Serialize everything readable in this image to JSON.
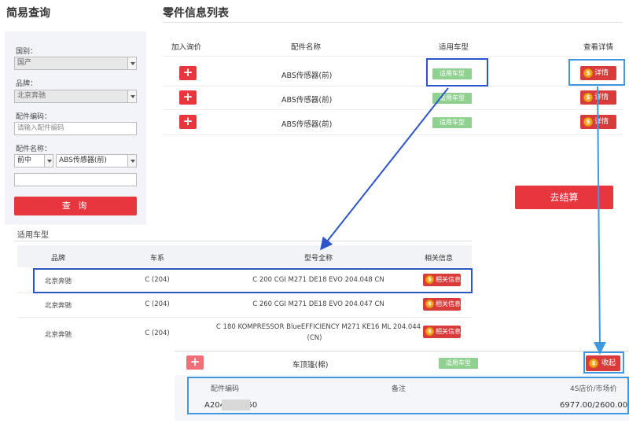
{
  "search": {
    "title": "简易查询",
    "country_label": "国别：",
    "country_value": "国产",
    "brand_label": "品牌：",
    "brand_value": "北京奔驰",
    "code_label": "配件编码：",
    "code_placeholder": "请输入配件编码",
    "name_label": "配件名称：",
    "position_value": "前中",
    "name_value": "ABS传感器(前)",
    "query_button": "查 询"
  },
  "parts": {
    "title": "零件信息列表",
    "columns": [
      "加入询价",
      "配件名称",
      "适用车型",
      "查看详情"
    ],
    "rows": [
      {
        "add": "+",
        "name": "ABS传感器(前)",
        "model_tag": "适用车型",
        "detail": "详情"
      },
      {
        "add": "+",
        "name": "ABS传感器(前)",
        "model_tag": "适用车型",
        "detail": "详情"
      },
      {
        "add": "+",
        "name": "ABS传感器(前)",
        "model_tag": "适用车型",
        "detail": "详情"
      }
    ],
    "checkout_button": "去结算"
  },
  "vehicles": {
    "title": "适用车型",
    "columns": [
      "品牌",
      "车系",
      "型号全称",
      "相关信息"
    ],
    "rows": [
      {
        "brand": "北京奔驰",
        "series": "C (204)",
        "model": "C 200 CGI M271 DE18 EVO 204.048 CN",
        "info": "相关信息"
      },
      {
        "brand": "北京奔驰",
        "series": "C (204)",
        "model": "C 260 CGI M271 DE18 EVO 204.047 CN",
        "info": "相关信息"
      },
      {
        "brand": "北京奔驰",
        "series": "C (204)",
        "model": "C 180 KOMPRESSOR BlueEFFICIENCY M271 KE16 ML 204.044",
        "model2": "(CN)",
        "info": "相关信息"
      }
    ]
  },
  "expanded": {
    "add": "+",
    "name": "车顶篷(棉)",
    "model_tag": "适用车型",
    "collapse": "收起",
    "columns": [
      "配件编码",
      "备注",
      "4S店价/市场价"
    ],
    "code": "A204       550",
    "price": "6977.00/2600.00"
  },
  "coin_symbol": "$",
  "colors": {
    "red": "#e8363e",
    "green_tag": "#8fd18f",
    "annot_dark_blue": "#2b55c8",
    "annot_light_blue": "#3f97e0"
  }
}
